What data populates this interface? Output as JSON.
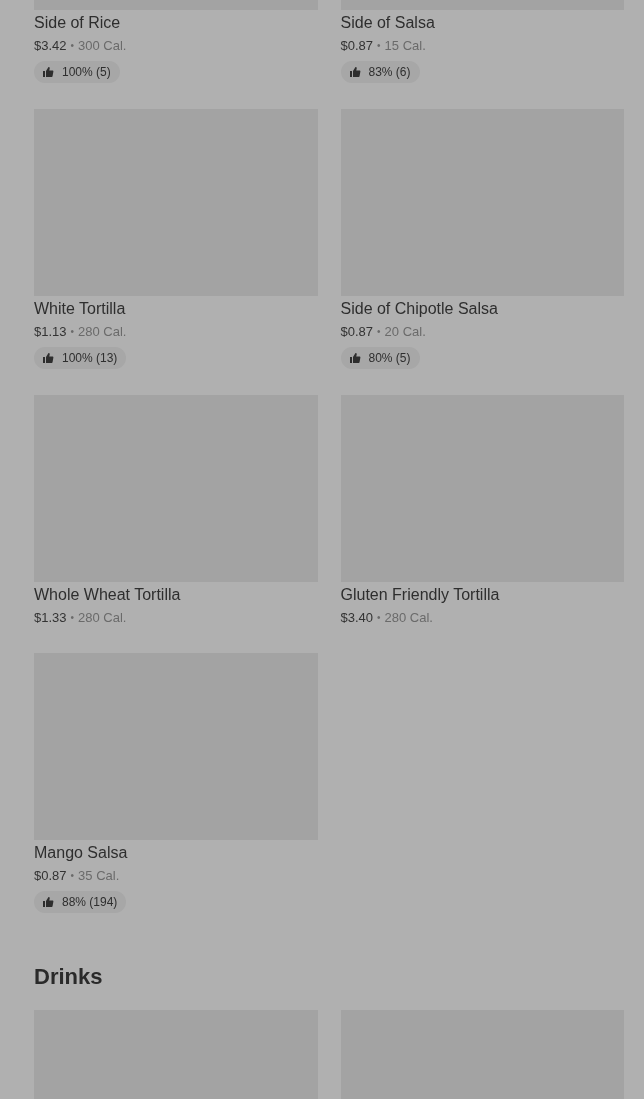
{
  "items": [
    {
      "name": "Side of Rice",
      "price": "$3.42",
      "separator": "•",
      "calories": "300 Cal.",
      "rating": "100% (5)"
    },
    {
      "name": "Side of Salsa",
      "price": "$0.87",
      "separator": "•",
      "calories": "15 Cal.",
      "rating": "83% (6)"
    },
    {
      "name": "White Tortilla",
      "price": "$1.13",
      "separator": "•",
      "calories": "280 Cal.",
      "rating": "100% (13)"
    },
    {
      "name": "Side of Chipotle Salsa",
      "price": "$0.87",
      "separator": "•",
      "calories": "20 Cal.",
      "rating": "80% (5)"
    },
    {
      "name": "Whole Wheat Tortilla",
      "price": "$1.33",
      "separator": "•",
      "calories": "280 Cal."
    },
    {
      "name": "Gluten Friendly Tortilla",
      "price": "$3.40",
      "separator": "•",
      "calories": "280 Cal."
    },
    {
      "name": "Mango Salsa",
      "price": "$0.87",
      "separator": "•",
      "calories": "35 Cal.",
      "rating": "88% (194)"
    }
  ],
  "drinks": {
    "title": "Drinks",
    "items": [
      {
        "kind": "placeholder"
      },
      {
        "kind": "placeholder"
      }
    ]
  }
}
